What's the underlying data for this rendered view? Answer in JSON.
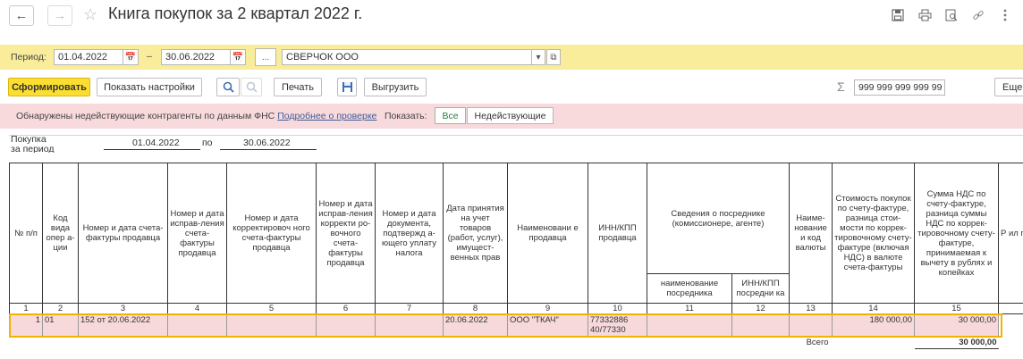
{
  "window": {
    "title": "Книга покупок за 2 квартал 2022 г."
  },
  "period": {
    "label": "Период:",
    "date_from": "01.04.2022",
    "dash": "–",
    "date_to": "30.06.2022",
    "ellipsis": "...",
    "organization": "СВЕРЧОК ООО"
  },
  "toolbar": {
    "generate": "Сформировать",
    "show_settings": "Показать настройки",
    "print": "Печать",
    "export": "Выгрузить",
    "sum_value": "999 999 999 999 99",
    "more": "Еще"
  },
  "alert": {
    "message": "Обнаружены недействующие контрагенты по данным ФНС",
    "link": "Подробнее о проверке",
    "show_label": "Показать:",
    "filter_all": "Все",
    "filter_inactive": "Недействующие"
  },
  "report": {
    "period_caption": "Покупка за период с",
    "date_from": "01.04.2022",
    "po": "по",
    "date_to": "30.06.2022",
    "columns": [
      "№ п/п",
      "Код вида опер а-ции",
      "Номер и дата счета-фактуры продавца",
      "Номер и дата исправ-ления счета-фактуры продавца",
      "Номер и дата корректировоч ного счета-фактуры продавца",
      "Номер и дата исправ-ления корректи ро-вочного счета-фактуры продавца",
      "Номер и дата документа, подтвержд а-ющего уплату налога",
      "Дата принятия на учет товаров (работ, услуг), имущест-венных прав",
      "Наименовани е продавца",
      "ИНН/КПП продавца",
      "Сведения о посреднике (комиссионере, агенте)",
      "Наиме-нование и код валюты",
      "Стоимость покупок по счету-фактуре, разница стои-мости по коррек-тировочному счету-фактуре (включая НДС) в валюте счета-фактуры",
      "Сумма НДС по счету-фактуре, разница суммы НДС по коррек-тировочному счету-фактуре, принимаемая к вычету в рублях и копейках",
      "Р ил пар"
    ],
    "sub_columns": [
      "наименование посредника",
      "ИНН/КПП посредни ка"
    ],
    "column_numbers": [
      "1",
      "2",
      "3",
      "4",
      "5",
      "6",
      "7",
      "8",
      "9",
      "10",
      "11",
      "12",
      "13",
      "14",
      "15"
    ],
    "row": {
      "num": "1",
      "op_code": "01",
      "invoice": "152 от 20.06.2022",
      "accept_date": "20.06.2022",
      "seller": "ООО \"ТКАЧ\"",
      "inn_kpp": "77332886 40/77330",
      "cost": "180 000,00",
      "vat": "30 000,00"
    },
    "total_label": "Всего",
    "total_value": "30 000,00"
  }
}
